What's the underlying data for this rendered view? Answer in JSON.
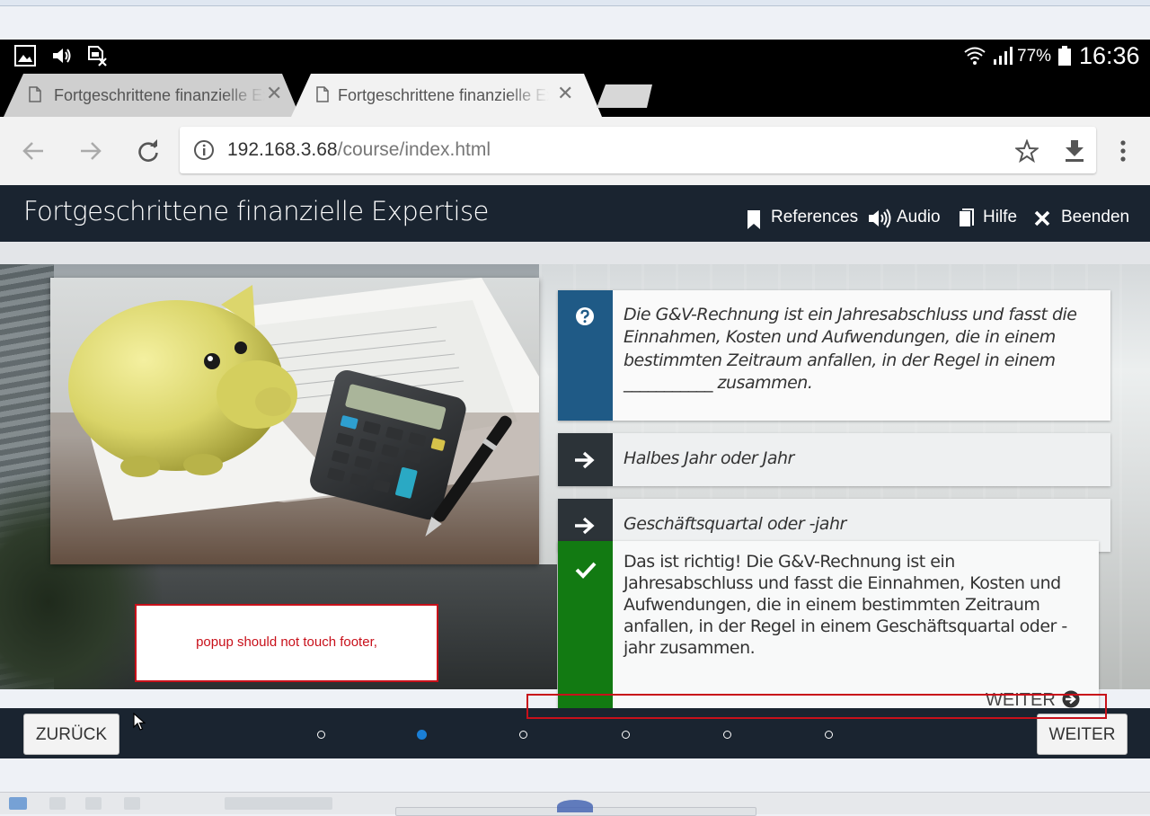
{
  "status_bar": {
    "battery": "77%",
    "time": "16:36"
  },
  "tabs": [
    {
      "title": "Fortgeschrittene finanzielle Expertise",
      "close": "✕",
      "active": false
    },
    {
      "title": "Fortgeschrittene finanzielle Expertise",
      "close": "✕",
      "active": true
    }
  ],
  "address_bar": {
    "host": "192.168.3.68",
    "path": "/course/index.html"
  },
  "course": {
    "title": "Fortgeschrittene finanzielle Expertise",
    "nav": [
      {
        "label": "References",
        "icon": "bookmark-icon"
      },
      {
        "label": "Audio",
        "icon": "speaker-icon"
      },
      {
        "label": "Hilfe",
        "icon": "book-icon"
      },
      {
        "label": "Beenden",
        "icon": "close-icon"
      }
    ]
  },
  "question": {
    "text": "Die G&V-Rechnung ist ein Jahresabschluss und fasst die Einnahmen, Kosten und Aufwendungen, die in einem bestimmten Zeitraum anfallen, in der Regel in einem ___________ zusammen.",
    "options": [
      "Halbes Jahr oder Jahr",
      "Geschäftsquartal oder -jahr"
    ]
  },
  "feedback": {
    "text": "Das ist richtig! Die G&V-Rechnung ist ein Jahresabschluss und fasst die Einnahmen, Kosten und Aufwendungen, die in einem bestimmten Zeitraum anfallen, in der Regel in einem Geschäftsquartal oder -jahr zusammen.",
    "next_label": "WEITER"
  },
  "annotation": {
    "note": "popup should not touch footer,"
  },
  "footer": {
    "back_label": "ZURÜCK",
    "next_label": "WEITER",
    "page_count": 6,
    "current_page": 2
  },
  "colors": {
    "header_bg": "#1a2430",
    "question_band": "#1f5a86",
    "option_band": "#2c3338",
    "correct_band": "#127a12",
    "annotation_red": "#c8101a",
    "active_dot": "#1a7fd6"
  }
}
